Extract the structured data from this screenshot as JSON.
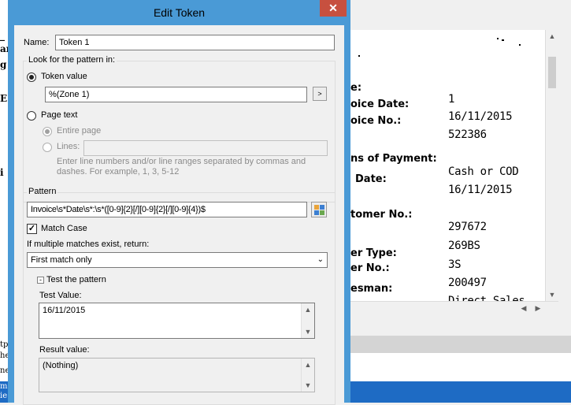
{
  "dialog": {
    "title": "Edit Token",
    "close_label": "✕",
    "name_label": "Name:",
    "name_value": "Token 1",
    "look_group_label": "Look for the pattern in:",
    "token_value_label": "Token value",
    "token_value": "%(Zone 1)",
    "browse_label": ">",
    "page_text_label": "Page text",
    "entire_page_label": "Entire page",
    "lines_label": "Lines:",
    "lines_value": "",
    "lines_hint": "Enter line numbers and/or line ranges separated by commas and dashes.  For example, 1, 3, 5-12",
    "pattern_group_label": "Pattern",
    "pattern_value": "Invoice\\s*Date\\s*:\\s*([0-9]{2}[/][0-9]{2}[/][0-9]{4})$",
    "match_case_label": "Match Case",
    "match_case_checked": true,
    "multi_match_label": "If multiple matches exist, return:",
    "multi_match_value": "First match only",
    "test_section_label": "Test the pattern",
    "test_value_label": "Test Value:",
    "test_value": "16/11/2015",
    "result_value_label": "Result value:",
    "result_value": "(Nothing)"
  },
  "document": {
    "labels": [
      "e:",
      "oice Date:",
      "oice No.:",
      "ns of Payment:",
      "Date:",
      "tomer No.:",
      "er Type:",
      "er No.:",
      "esman:"
    ],
    "values": [
      "1",
      "16/11/2015",
      "522386",
      "Cash or COD",
      "16/11/2015",
      "297672",
      "269BS",
      "3S",
      "200497",
      "Direct Sales"
    ]
  },
  "background_left": {
    "fragments": [
      "_",
      "ar",
      "g",
      "E",
      "i",
      "tp",
      "he",
      "ne",
      "m",
      "ie"
    ]
  },
  "colors": {
    "dialog_frame": "#4a9ad6",
    "close_button": "#c7503f",
    "taskbar_blue": "#1e6bc4"
  }
}
